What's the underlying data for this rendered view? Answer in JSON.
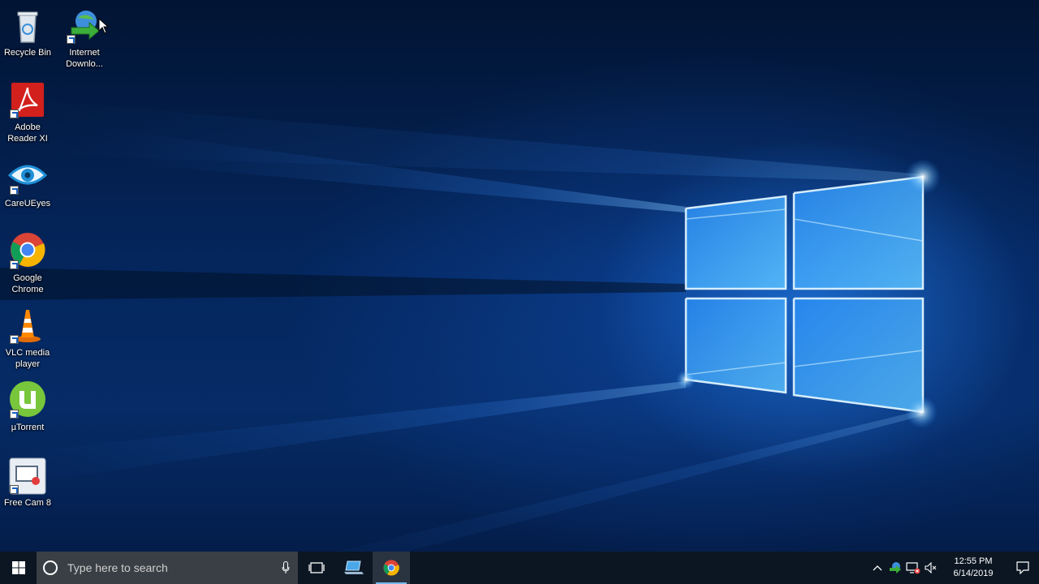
{
  "desktop": {
    "icons": [
      {
        "label": "Recycle Bin",
        "icon": "recycle-bin-icon"
      },
      {
        "label": "Internet\nDownlo...",
        "icon": "internet-download-manager-icon"
      },
      {
        "label": "Adobe\nReader XI",
        "icon": "adobe-reader-icon"
      },
      {
        "label": "CareUEyes",
        "icon": "careueyes-icon"
      },
      {
        "label": "Google\nChrome",
        "icon": "chrome-icon"
      },
      {
        "label": "VLC media\nplayer",
        "icon": "vlc-icon"
      },
      {
        "label": "µTorrent",
        "icon": "utorrent-icon"
      },
      {
        "label": "Free Cam 8",
        "icon": "free-cam-icon"
      }
    ]
  },
  "taskbar": {
    "search_placeholder": "Type here to search",
    "apps": [
      {
        "name": "task-view",
        "icon": "task-view-icon"
      },
      {
        "name": "file-explorer-laptop",
        "icon": "laptop-icon"
      },
      {
        "name": "google-chrome",
        "icon": "chrome-icon",
        "active": true
      }
    ],
    "clock": {
      "time": "12:55 PM",
      "date": "6/14/2019"
    }
  },
  "colors": {
    "taskbar_bg": "#0b1622",
    "search_bg": "#3a3f45",
    "accent": "#76b9ed",
    "wallpaper_glow": "#58b8ff"
  }
}
